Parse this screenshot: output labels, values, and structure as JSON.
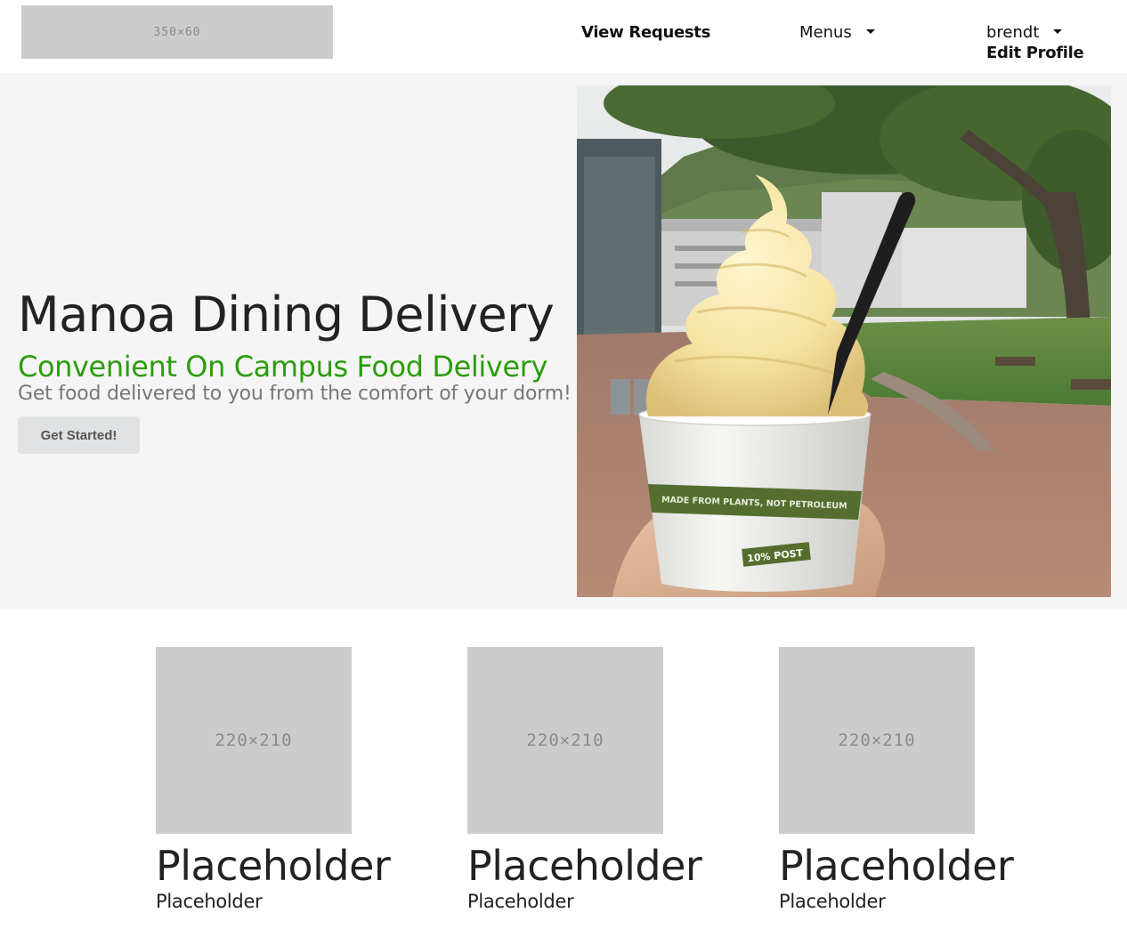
{
  "header": {
    "logo_text": "350×60",
    "nav": {
      "view_requests": "View Requests",
      "menus": "Menus",
      "username": "brendt",
      "edit_profile": "Edit Profile"
    }
  },
  "hero": {
    "title": "Manoa Dining Delivery",
    "subtitle": "Convenient On Campus Food Delivery",
    "description": "Get food delivered to you from the comfort of your dorm!",
    "cta_label": "Get Started!",
    "photo": {
      "cup_band_text": "MADE FROM PLANTS, NOT PETROLEUM",
      "cup_badge_text": "10% POST"
    }
  },
  "cards": [
    {
      "image_text": "220×210",
      "title": "Placeholder",
      "subtitle": "Placeholder"
    },
    {
      "image_text": "220×210",
      "title": "Placeholder",
      "subtitle": "Placeholder"
    },
    {
      "image_text": "220×210",
      "title": "Placeholder",
      "subtitle": "Placeholder"
    }
  ],
  "colors": {
    "accent_green": "#2c9c0c",
    "hero_bg": "#f5f5f5",
    "placeholder_bg": "#cccccc",
    "button_bg": "#e0e1e2"
  }
}
